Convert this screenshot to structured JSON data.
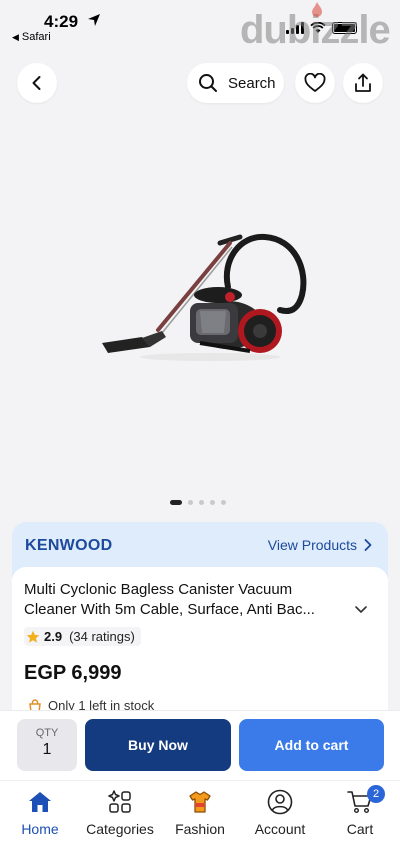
{
  "status_bar": {
    "time": "4:29",
    "back_app": "Safari"
  },
  "watermark": "dubizzle",
  "top_nav": {
    "search_label": "Search"
  },
  "gallery": {
    "total_images": 5,
    "active_index": 0
  },
  "brand": {
    "name": "KENWOOD",
    "link": "View Products"
  },
  "product": {
    "title": "Multi Cyclonic Bagless Canister Vacuum Cleaner With 5m Cable, Surface, Anti Bac...",
    "rating": "2.9",
    "rating_count": "(34 ratings)",
    "price": "EGP 6,999",
    "stock_note": "Only 1 left in stock"
  },
  "actions": {
    "qty_label": "QTY",
    "qty_value": "1",
    "buy_now": "Buy Now",
    "add_to_cart": "Add to cart"
  },
  "bottom_nav": {
    "items": [
      {
        "label": "Home",
        "icon": "home-icon",
        "active": true
      },
      {
        "label": "Categories",
        "icon": "categories-icon",
        "active": false
      },
      {
        "label": "Fashion",
        "icon": "fashion-icon",
        "active": false
      },
      {
        "label": "Account",
        "icon": "account-icon",
        "active": false
      },
      {
        "label": "Cart",
        "icon": "cart-icon",
        "active": false
      }
    ],
    "cart_badge": "2"
  },
  "colors": {
    "brand_blue": "#1d4a9c",
    "buy_now_bg": "#143a80",
    "add_cart_bg": "#3a7be9",
    "brand_card_bg": "#deecfb",
    "star": "#f2b01e"
  }
}
